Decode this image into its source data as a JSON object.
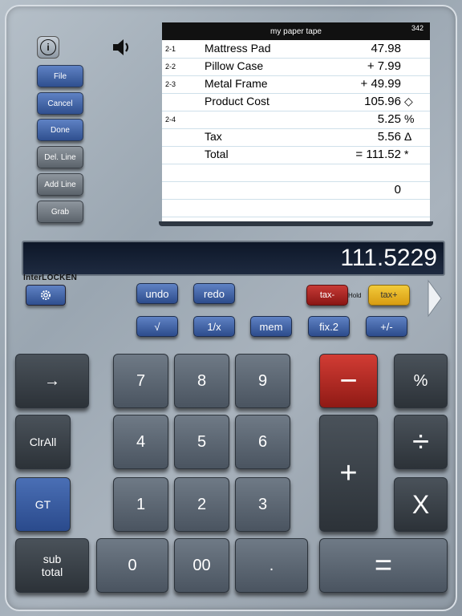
{
  "toolbar": {
    "file": "File",
    "cancel": "Cancel",
    "done": "Done",
    "del_line": "Del. Line",
    "add_line": "Add Line",
    "grab": "Grab",
    "info_glyph": "i"
  },
  "tape": {
    "title": "my paper tape",
    "count": "342",
    "rows": [
      {
        "ref": "2-1",
        "label": "Mattress Pad",
        "value": "47.98",
        "mark": ""
      },
      {
        "ref": "2-2",
        "label": "Pillow Case",
        "value": "+ 7.99",
        "mark": ""
      },
      {
        "ref": "2-3",
        "label": "Metal Frame",
        "value": "+ 49.99",
        "mark": ""
      },
      {
        "ref": "",
        "label": "Product Cost",
        "value": "105.96",
        "mark": "◇"
      },
      {
        "ref": "2-4",
        "label": "",
        "value": "5.25",
        "mark": "%"
      },
      {
        "ref": "",
        "label": "Tax",
        "value": "5.56",
        "mark": "Δ"
      },
      {
        "ref": "",
        "label": "Total",
        "value": "= 111.52",
        "mark": "*"
      },
      {
        "ref": "",
        "label": "",
        "value": "",
        "mark": ""
      },
      {
        "ref": "",
        "label": "",
        "value": "0",
        "mark": ""
      },
      {
        "ref": "",
        "label": "",
        "value": "",
        "mark": ""
      }
    ]
  },
  "display": {
    "value": "111.5229"
  },
  "brand": "InterLOCKEN",
  "functions": {
    "undo": "undo",
    "redo": "redo",
    "tax_minus": "tax-",
    "hold": "Hold",
    "tax_plus": "tax+",
    "sqrt": "√",
    "reciprocal": "1/x",
    "mem": "mem",
    "fix": "fix.2",
    "sign": "+/-"
  },
  "keys": {
    "arrow": "→",
    "clrall": "ClrAll",
    "gt": "GT",
    "subtotal_line1": "sub",
    "subtotal_line2": "total",
    "k7": "7",
    "k8": "8",
    "k9": "9",
    "k4": "4",
    "k5": "5",
    "k6": "6",
    "k1": "1",
    "k2": "2",
    "k3": "3",
    "k0": "0",
    "k00": "00",
    "dot": ".",
    "minus": "−",
    "plus": "+",
    "equals": "=",
    "percent": "%",
    "divide": "÷",
    "multiply": "X"
  },
  "colors": {
    "accent_blue": "#2f4f8f",
    "tax_minus_red": "#8a1614",
    "tax_plus_yellow": "#d89c12",
    "minus_key_red": "#c0392b"
  }
}
